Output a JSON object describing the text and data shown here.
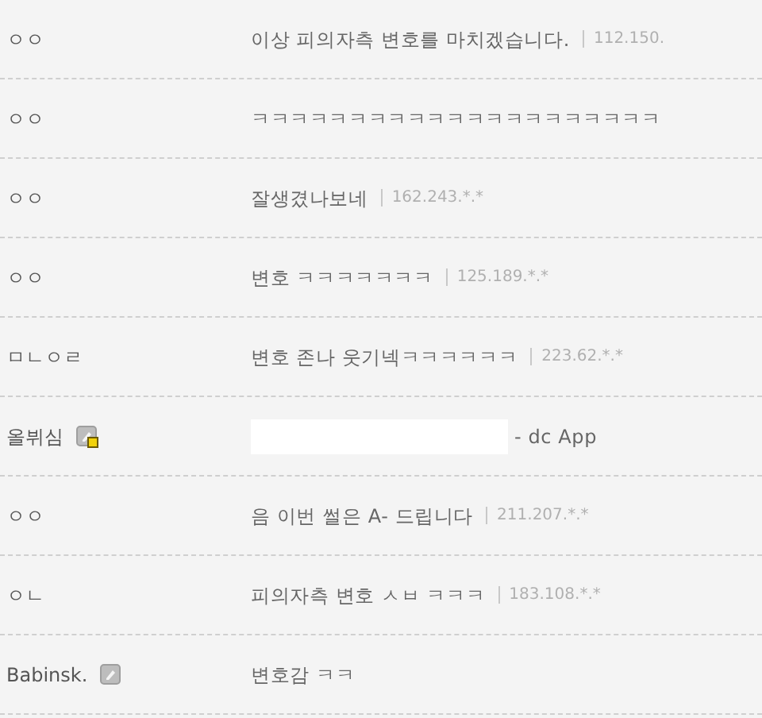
{
  "comments": [
    {
      "name": "ㅇㅇ",
      "text": "이상 피의자측 변호를 마치겠습니다.",
      "ip": "112.150."
    },
    {
      "name": "ㅇㅇ",
      "text": "ㅋㅋㅋㅋㅋㅋㅋㅋㅋㅋㅋㅋㅋㅋㅋㅋㅋㅋㅋㅋㅋ"
    },
    {
      "name": "ㅇㅇ",
      "text": "잘생겼나보네",
      "ip": "162.243.*.*"
    },
    {
      "name": "ㅇㅇ",
      "text": "변호 ㅋㅋㅋㅋㅋㅋㅋ",
      "ip": "125.189.*.*"
    },
    {
      "name": "ㅁㄴㅇㄹ",
      "text": "변호 존나 웃기넥ㅋㅋㅋㅋㅋㅋ",
      "ip": "223.62.*.*"
    },
    {
      "name": "올뷔심",
      "member": true,
      "fixed_nick": true,
      "redacted": true,
      "text": "- dc App"
    },
    {
      "name": "ㅇㅇ",
      "text": "음 이번 썰은 A- 드립니다",
      "ip": "211.207.*.*"
    },
    {
      "name": "ㅇㄴ",
      "text": "피의자측 변호 ㅅㅂ ㅋㅋㅋ",
      "ip": "183.108.*.*"
    },
    {
      "name": "Babinsk.",
      "member": true,
      "fixed_nick": false,
      "text": "변호감 ㅋㅋ"
    }
  ]
}
